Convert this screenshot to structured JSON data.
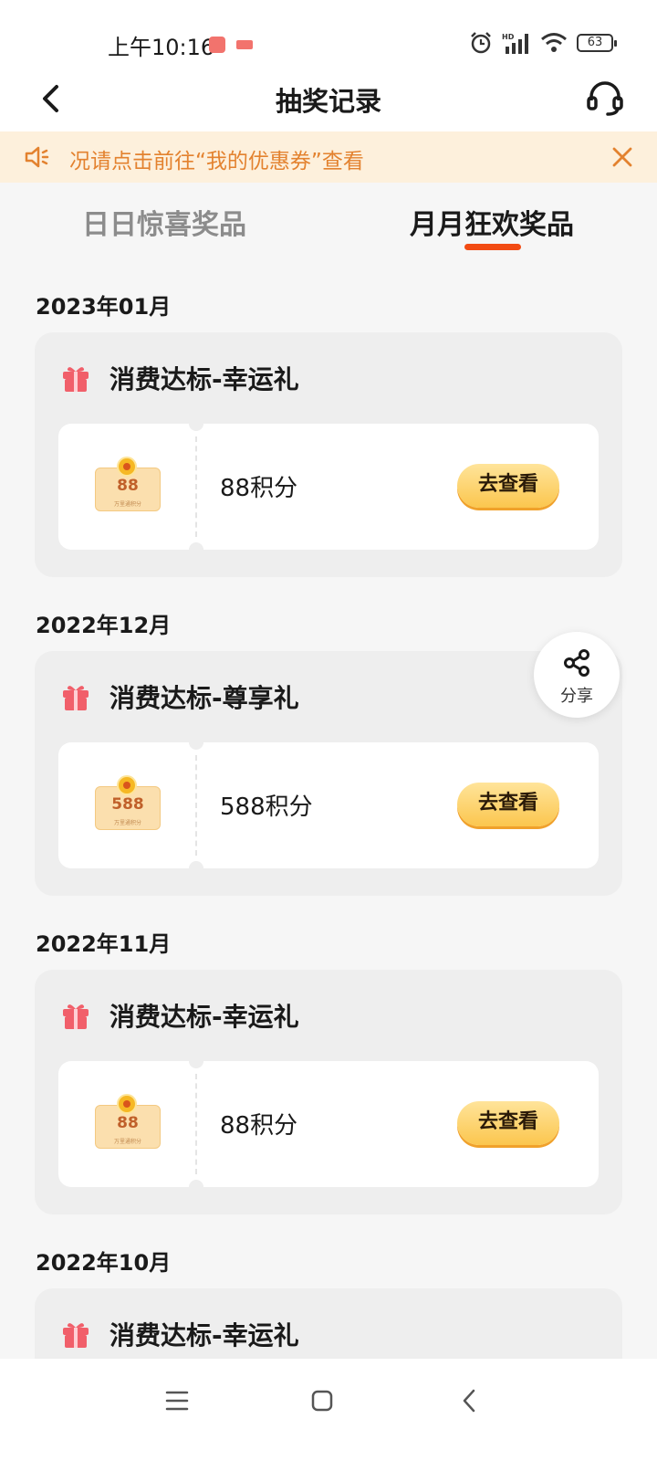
{
  "status_bar": {
    "time": "上午10:16",
    "battery": "63",
    "network": "HD"
  },
  "header": {
    "title": "抽奖记录",
    "back_icon": "chevron-left-icon",
    "service_icon": "headset-icon"
  },
  "notice": {
    "text": "况请点击前往“我的优惠券”查看",
    "icon": "speaker-icon",
    "close_icon": "close-icon"
  },
  "tabs": [
    {
      "label": "日日惊喜奖品",
      "active": false
    },
    {
      "label": "月月狂欢奖品",
      "active": true
    }
  ],
  "records": [
    {
      "month": "2023年01月",
      "title": "消费达标-幸运礼",
      "coupon_value": "88",
      "coupon_sub": "万里通积分",
      "points": "88积分",
      "action": "去查看"
    },
    {
      "month": "2022年12月",
      "title": "消费达标-尊享礼",
      "coupon_value": "588",
      "coupon_sub": "万里通积分",
      "points": "588积分",
      "action": "去查看"
    },
    {
      "month": "2022年11月",
      "title": "消费达标-幸运礼",
      "coupon_value": "88",
      "coupon_sub": "万里通积分",
      "points": "88积分",
      "action": "去查看"
    },
    {
      "month": "2022年10月",
      "title": "消费达标-幸运礼"
    }
  ],
  "share": {
    "label": "分享",
    "icon": "share-icon"
  },
  "colors": {
    "accent": "#f24b13",
    "notice_bg": "#fdf0dc",
    "notice_text": "#e3822f",
    "button_gold": "#fbc64e",
    "gift_red": "#f15f6a"
  },
  "bottom_nav": {
    "menu_icon": "menu-icon",
    "home_icon": "home-square-icon",
    "back_icon": "back-triangle-icon"
  }
}
